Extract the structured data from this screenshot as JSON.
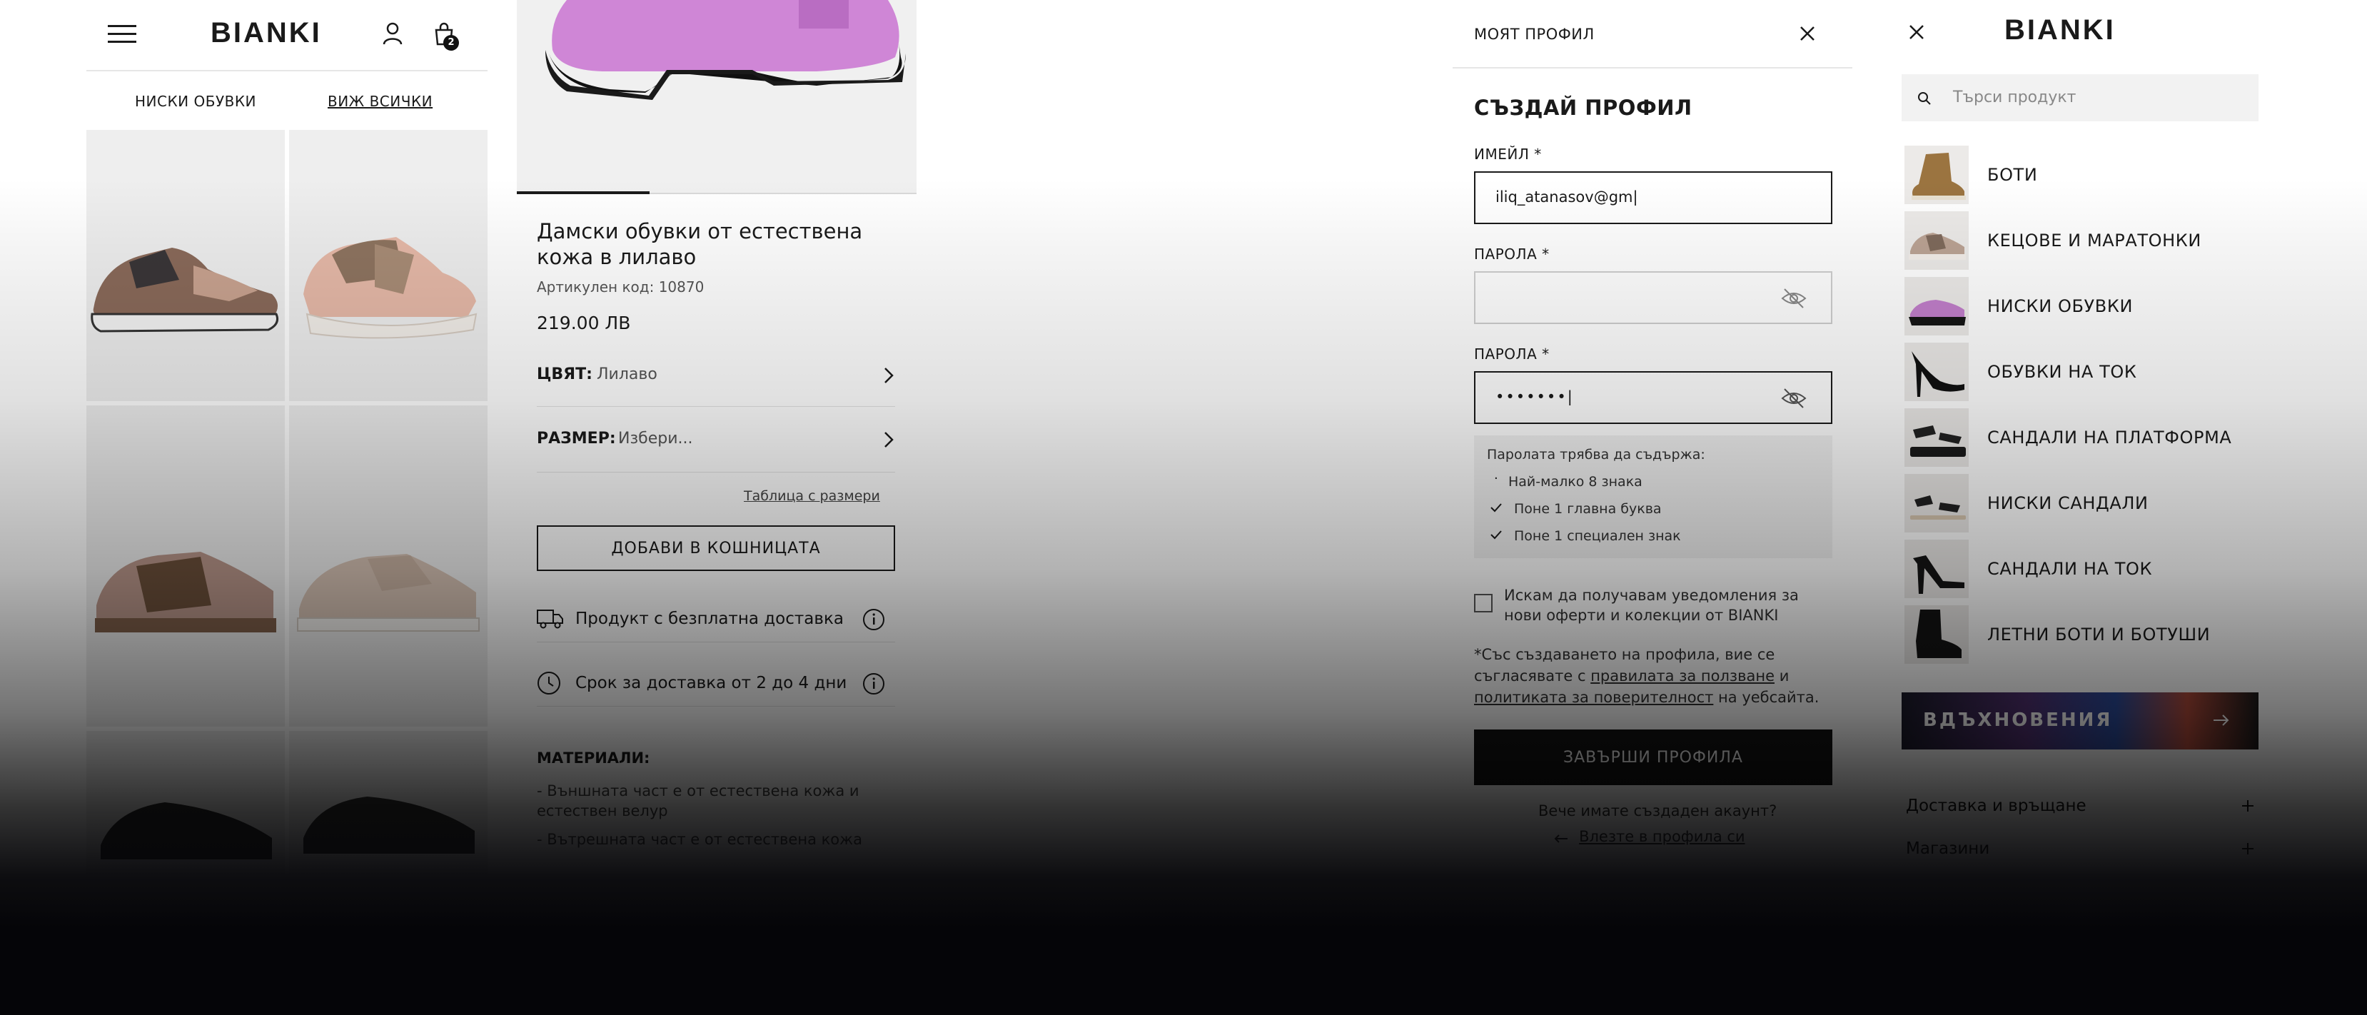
{
  "panel1": {
    "logo": "BIANKI",
    "cart_count": "2",
    "category": "НИСКИ ОБУВКИ",
    "view_all": "ВИЖ ВСИЧКИ"
  },
  "panel2": {
    "title": "Дамски обувки от естествена кожа в лилаво",
    "sku": "Артикулен код: 10870",
    "price": "219.00 ЛВ",
    "color_label": "ЦВЯТ:",
    "color_value": "Лилаво",
    "size_label": "РАЗМЕР:",
    "size_value": "Избери...",
    "size_chart_link": "Таблица с размери",
    "add_to_cart": "ДОБАВИ В КОШНИЦАТА",
    "free_shipping": "Продукт с безплатна доставка",
    "delivery_time": "Срок за доставка от 2 до 4 дни",
    "materials_heading": "МАТЕРИАЛИ:",
    "material_1": "- Външната част е от естествена кожа и естествен велур",
    "material_2": "- Вътрешната част е от естествена кожа"
  },
  "panel3": {
    "header": "МОЯТ ПРОФИЛ",
    "title": "СЪЗДАЙ ПРОФИЛ",
    "email_label": "ИМЕЙЛ *",
    "email_value": "iliq_atanasov@gm|",
    "password_label": "ПАРОЛА *",
    "password_value": "",
    "password2_label": "ПАРОЛА *",
    "password2_value": "•••••••|",
    "rules_heading": "Паролата трябва да съдържа:",
    "rule_1": "Най-малко 8 знака",
    "rule_2": "Поне 1 главна буква",
    "rule_3": "Поне 1 специален знак",
    "newsletter": "Искам да получавам уведомления за нови оферти и колекции от BIANKI",
    "terms_prefix": "*Със създаването на профила, вие се съгласявате с",
    "terms_link": "правилата за ползване",
    "terms_and": "и",
    "privacy_link": "политиката за поверителност",
    "terms_suffix": "на уебсайта.",
    "submit": "ЗАВЪРШИ ПРОФИЛА",
    "have_account": "Вече имате създаден акаунт?",
    "login_link": "Влезте в профила си"
  },
  "panel4": {
    "logo": "BIANKI",
    "search_placeholder": "Търси продукт",
    "menu": [
      {
        "label": "БОТИ"
      },
      {
        "label": "КЕЦОВЕ И МАРАТОНКИ"
      },
      {
        "label": "НИСКИ ОБУВКИ"
      },
      {
        "label": "ОБУВКИ НА ТОК"
      },
      {
        "label": "САНДАЛИ НА ПЛАТФОРМА"
      },
      {
        "label": "НИСКИ САНДАЛИ"
      },
      {
        "label": "САНДАЛИ НА ТОК"
      },
      {
        "label": "ЛЕТНИ БОТИ И БОТУШИ"
      }
    ],
    "inspiration": "ВДЪХНОВЕНИЯ",
    "delivery_returns": "Доставка и връщане",
    "stores": "Магазини"
  },
  "colors": {
    "text": "#1a1a1a",
    "lilac_shoe": "#cf86d6",
    "submit_bg": "#141414",
    "rules_bg": "#f2f2f2"
  }
}
